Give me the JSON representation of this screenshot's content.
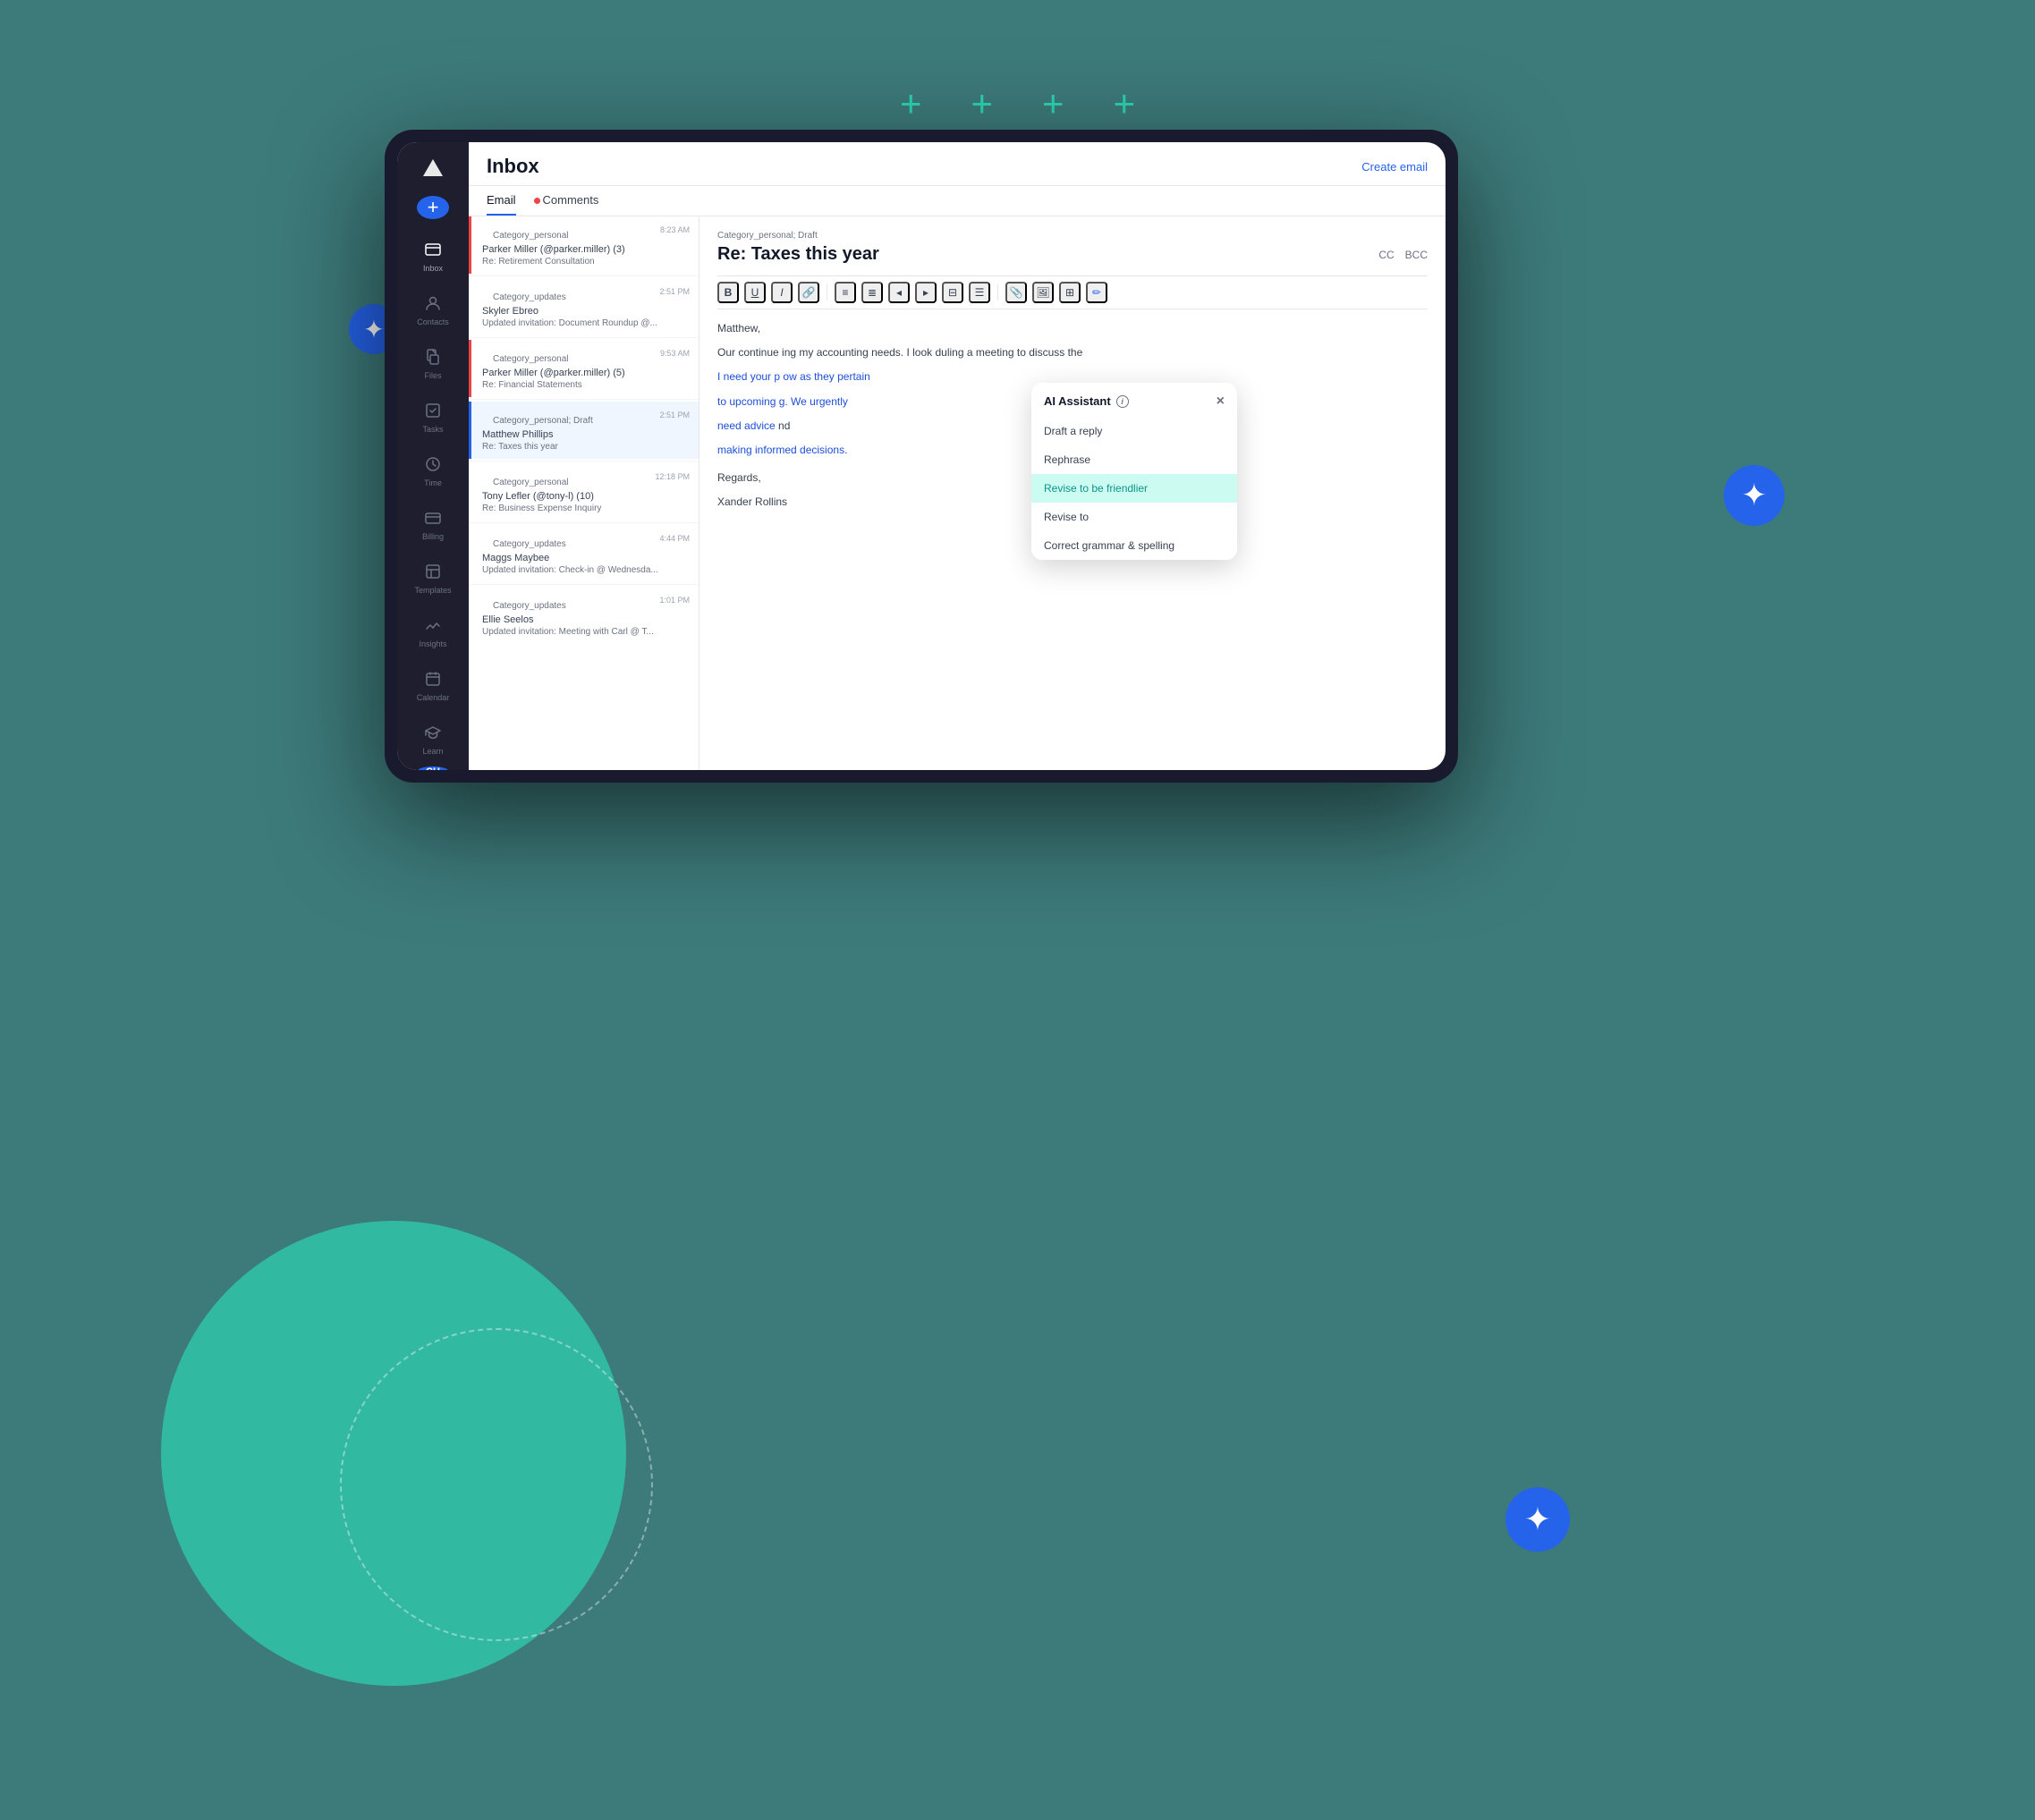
{
  "background": {
    "color": "#3d7a7a"
  },
  "decorative": {
    "plus_signs": [
      "+",
      "+",
      "+",
      "+"
    ],
    "circle_color": "#2dd4b4"
  },
  "tablet": {
    "header": {
      "title": "Inbox",
      "create_email_label": "Create email"
    },
    "tabs": [
      {
        "label": "Email",
        "active": true
      },
      {
        "label": "Comments",
        "active": false,
        "dot": true
      }
    ],
    "sidebar": {
      "logo_alt": "App logo",
      "add_label": "+",
      "avatar": "CH",
      "items": [
        {
          "label": "Inbox",
          "active": true,
          "icon": "inbox"
        },
        {
          "label": "Contacts",
          "active": false,
          "icon": "contacts"
        },
        {
          "label": "Files",
          "active": false,
          "icon": "files"
        },
        {
          "label": "Tasks",
          "active": false,
          "icon": "tasks"
        },
        {
          "label": "Time",
          "active": false,
          "icon": "time"
        },
        {
          "label": "Billing",
          "active": false,
          "icon": "billing"
        },
        {
          "label": "Templates",
          "active": false,
          "icon": "templates"
        },
        {
          "label": "Insights",
          "active": false,
          "icon": "insights"
        },
        {
          "label": "Calendar",
          "active": false,
          "icon": "calendar"
        },
        {
          "label": "Learn",
          "active": false,
          "icon": "learn"
        }
      ]
    },
    "email_list": {
      "items": [
        {
          "category": "Category_personal",
          "sender": "Parker Miller (@parker.miller) (3)",
          "subject": "Re: Retirement Consultation",
          "time": "8:23 AM",
          "highlight": true,
          "active": false
        },
        {
          "category": "Category_updates",
          "sender": "Skyler Ebreo",
          "subject": "Updated invitation: Document Roundup @...",
          "time": "2:51 PM",
          "highlight": false,
          "active": false
        },
        {
          "category": "Category_personal",
          "sender": "Parker Miller (@parker.miller) (5)",
          "subject": "Re: Financial Statements",
          "time": "9:53 AM",
          "highlight": true,
          "active": false
        },
        {
          "category": "Category_personal; Draft",
          "sender": "Matthew Phillips",
          "subject": "Re: Taxes this year",
          "time": "2:51 PM",
          "highlight": false,
          "active": true
        },
        {
          "category": "Category_personal",
          "sender": "Tony Lefler (@tony-l) (10)",
          "subject": "Re: Business Expense Inquiry",
          "time": "12:18 PM",
          "highlight": false,
          "active": false
        },
        {
          "category": "Category_updates",
          "sender": "Maggs Maybee",
          "subject": "Updated invitation: Check-in @ Wednesda...",
          "time": "4:44 PM",
          "highlight": false,
          "active": false
        },
        {
          "category": "Category_updates",
          "sender": "Ellie Seelos",
          "subject": "Updated invitation: Meeting with Carl @ T...",
          "time": "1:01 PM",
          "highlight": false,
          "active": false
        }
      ]
    },
    "email_detail": {
      "meta": "Category_personal; Draft",
      "subject": "Re: Taxes this year",
      "cc_label": "CC",
      "bcc_label": "BCC",
      "toolbar_buttons": [
        "B",
        "U",
        "I",
        "🔗",
        "≡",
        "≣",
        "◀",
        "▶",
        "⊟",
        "☰",
        "|",
        "📎",
        "🖼",
        "⊞",
        "✏"
      ],
      "greeting": "Matthew,",
      "body_intro": "Our continue",
      "body_text": "ing my accounting needs. I look",
      "body_continue": "duling a meeting to discuss the",
      "body_highlight": "I need your p to upcoming need advice making informed decisions.",
      "body_highlight_part1": "I need your p",
      "body_highlight_part2": "to upcoming",
      "body_highlight_part3": "need advice",
      "body_highlight_part4": "making informed decisions.",
      "body_suffix1": "ow as they pertain",
      "body_suffix2": "g. We urgently",
      "body_suffix3": "nd",
      "signature_1": "Regards,",
      "signature_2": "Xander Rollins"
    },
    "ai_assistant": {
      "title": "AI Assistant",
      "close_label": "×",
      "menu_items": [
        {
          "label": "Draft a reply",
          "active": false
        },
        {
          "label": "Rephrase",
          "active": false
        },
        {
          "label": "Revise to be friendlier",
          "active": true
        },
        {
          "label": "Revise to",
          "active": false
        },
        {
          "label": "Correct grammar & spelling",
          "active": false
        }
      ]
    }
  },
  "floating_buttons": {
    "star_symbol": "✦"
  }
}
